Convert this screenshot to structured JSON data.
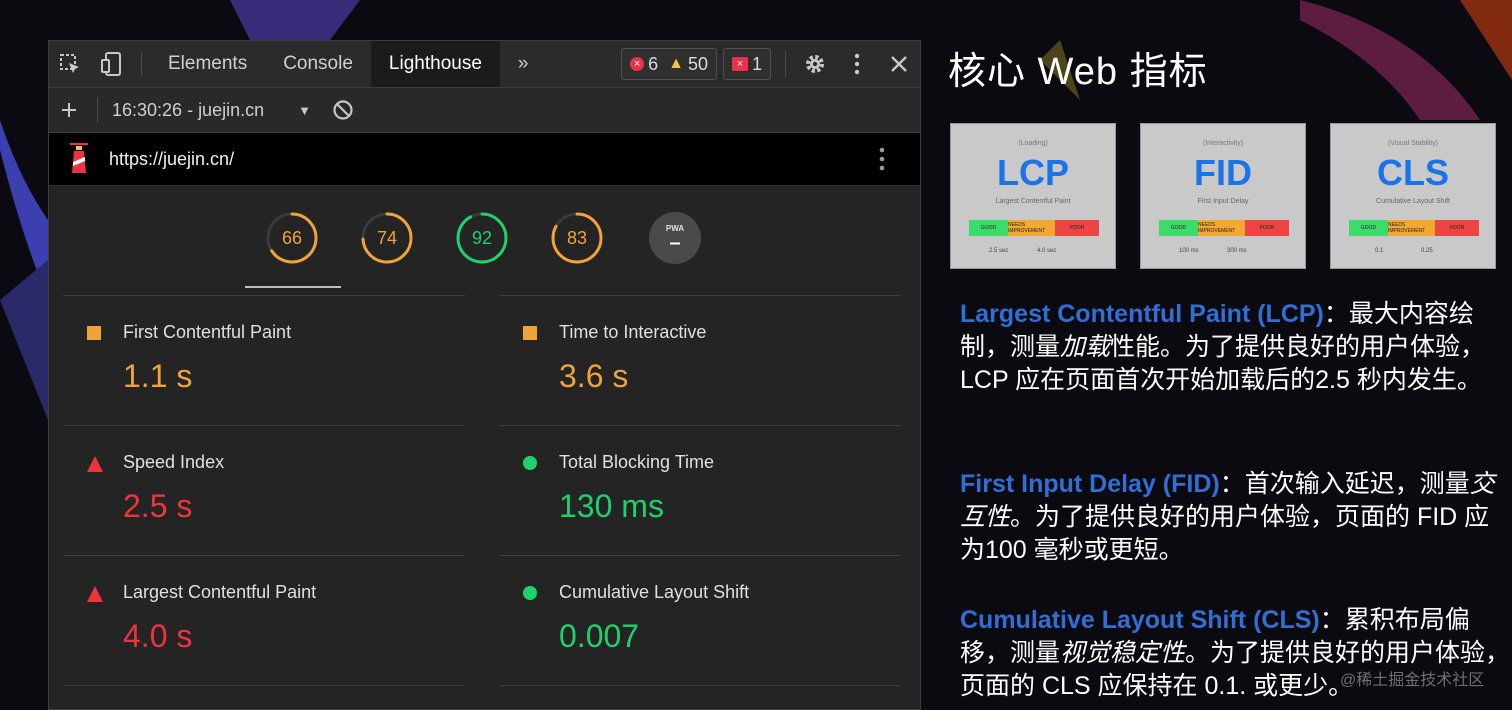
{
  "devtools": {
    "tabs": [
      "Elements",
      "Console",
      "Lighthouse"
    ],
    "active_tab": "Lighthouse",
    "more_tabs": "»",
    "errors": "6",
    "warnings": "50",
    "issues": "1",
    "report_label": "16:30:26 - juejin.cn",
    "url": "https://juejin.cn/"
  },
  "scores": [
    {
      "value": "66",
      "fraction": 0.66,
      "color": "#f0a338"
    },
    {
      "value": "74",
      "fraction": 0.74,
      "color": "#f0a338"
    },
    {
      "value": "92",
      "fraction": 0.92,
      "color": "#1ed26b"
    },
    {
      "value": "83",
      "fraction": 0.83,
      "color": "#f0a338"
    }
  ],
  "pwa": {
    "label": "PWA",
    "value": "–"
  },
  "metrics": [
    {
      "label": "First Contentful Paint",
      "value": "1.1 s",
      "status": "orange"
    },
    {
      "label": "Time to Interactive",
      "value": "3.6 s",
      "status": "orange"
    },
    {
      "label": "Speed Index",
      "value": "2.5 s",
      "status": "red"
    },
    {
      "label": "Total Blocking Time",
      "value": "130 ms",
      "status": "green"
    },
    {
      "label": "Largest Contentful Paint",
      "value": "4.0 s",
      "status": "red"
    },
    {
      "label": "Cumulative Layout Shift",
      "value": "0.007",
      "status": "green"
    }
  ],
  "slide": {
    "title": "核心 Web 指标",
    "cards": [
      {
        "top": "(Loading)",
        "abbr": "LCP",
        "sub": "Largest Contentful Paint",
        "scale": [
          "GOOD",
          "NEEDS IMPROVEMENT",
          "POOR"
        ],
        "t1": "2.5 sec",
        "t2": "4.0 sec"
      },
      {
        "top": "(Interactivity)",
        "abbr": "FID",
        "sub": "First Input Delay",
        "scale": [
          "GOOD",
          "NEEDS IMPROVEMENT",
          "POOR"
        ],
        "t1": "100 ms",
        "t2": "300 ms"
      },
      {
        "top": "(Visual Stability)",
        "abbr": "CLS",
        "sub": "Cumulative Layout Shift",
        "scale": [
          "GOOD",
          "NEEDS IMPROVEMENT",
          "POOR"
        ],
        "t1": "0.1",
        "t2": "0.25"
      }
    ],
    "desc": [
      {
        "key": "Largest Contentful Paint (LCP)",
        "pre": "：最大内容绘制，测量",
        "em": "加载",
        "post": "性能。为了提供良好的用户体验，LCP 应在页面首次开始加载后的2.5 秒内发生。"
      },
      {
        "key": "First Input Delay (FID)",
        "pre": "：首次输入延迟，测量",
        "em": "交互性",
        "post": "。为了提供良好的用户体验，页面的 FID 应为100 毫秒或更短。"
      },
      {
        "key": "Cumulative Layout Shift (CLS)",
        "pre": "：累积布局偏移，测量",
        "em": "视觉稳定性",
        "post": "。为了提供良好的用户体验，页面的 CLS 应保持在 0.1. 或更少。"
      }
    ],
    "watermark": "@稀土掘金技术社区"
  }
}
